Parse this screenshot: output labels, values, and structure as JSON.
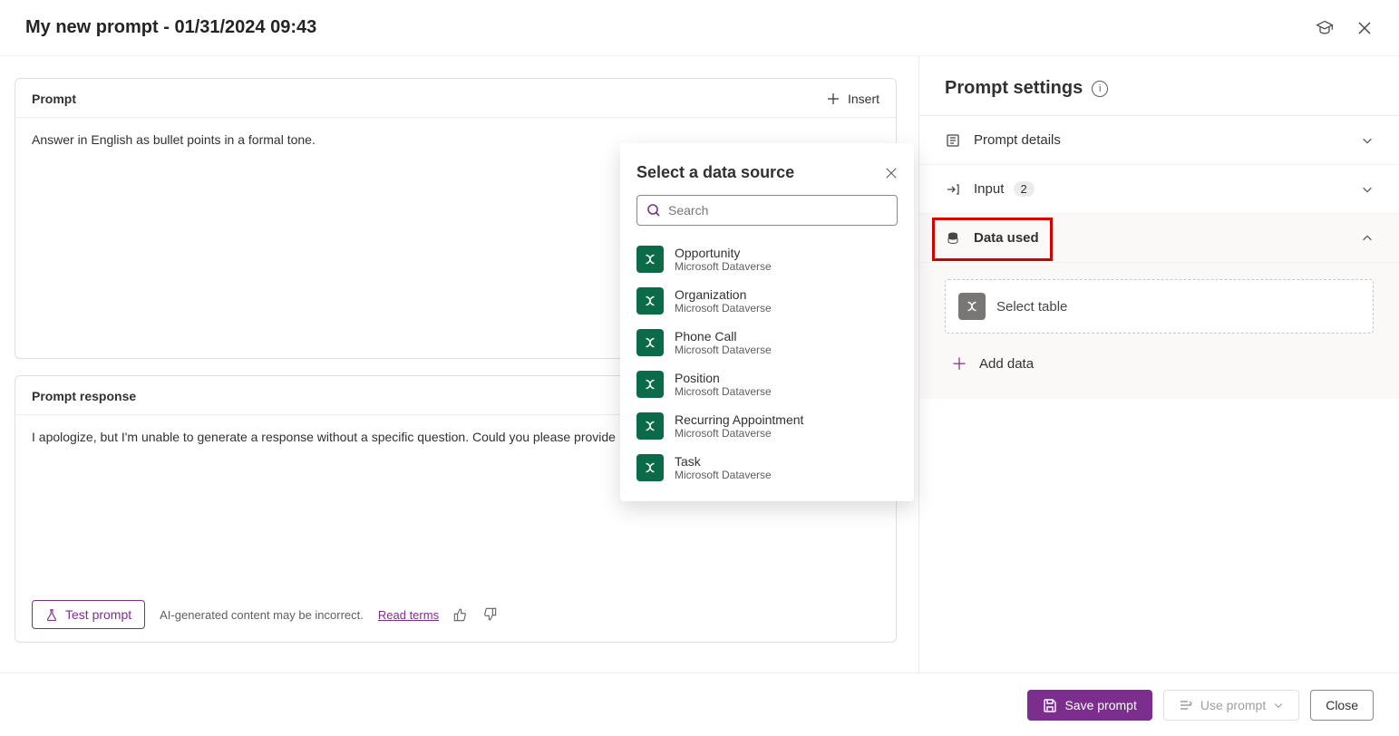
{
  "title": "My new prompt - 01/31/2024 09:43",
  "prompt": {
    "header_label": "Prompt",
    "insert_label": "Insert",
    "body": "Answer in English as bullet points in a formal tone."
  },
  "response": {
    "header_label": "Prompt response",
    "body": "I apologize, but I'm unable to generate a response without a specific question. Could you please provide",
    "test_label": "Test prompt",
    "disclaimer": "AI-generated content may be incorrect.",
    "terms_link": "Read terms"
  },
  "settings": {
    "title": "Prompt settings",
    "rows": {
      "details": "Prompt details",
      "input": "Input",
      "input_badge": "2",
      "data_used": "Data used"
    },
    "select_table": "Select table",
    "add_data": "Add data"
  },
  "popup": {
    "title": "Select a data source",
    "search_placeholder": "Search",
    "items": [
      {
        "name": "Opportunity",
        "sub": "Microsoft Dataverse"
      },
      {
        "name": "Organization",
        "sub": "Microsoft Dataverse"
      },
      {
        "name": "Phone Call",
        "sub": "Microsoft Dataverse"
      },
      {
        "name": "Position",
        "sub": "Microsoft Dataverse"
      },
      {
        "name": "Recurring Appointment",
        "sub": "Microsoft Dataverse"
      },
      {
        "name": "Task",
        "sub": "Microsoft Dataverse"
      }
    ]
  },
  "footer": {
    "save": "Save prompt",
    "use": "Use prompt",
    "close": "Close"
  }
}
